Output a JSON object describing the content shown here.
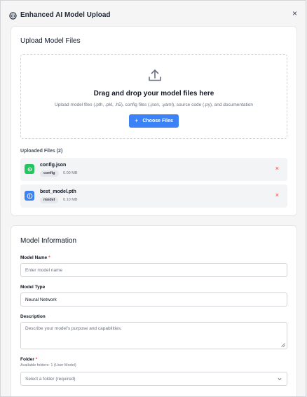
{
  "modal": {
    "title": "Enhanced AI Model Upload",
    "close_label": "×"
  },
  "upload": {
    "section_title": "Upload Model Files",
    "dropzone_title": "Drag and drop your model files here",
    "dropzone_subtitle": "Upload model files (.pth, .pkl, .h5), config files (.json, .yaml), source code (.py), and documentation",
    "choose_button": "Choose Files",
    "files_heading": "Uploaded Files (2)",
    "files": [
      {
        "name": "config.json",
        "tag": "config",
        "size": "0.00 MB",
        "icon": "gear-icon",
        "color": "#22c55e"
      },
      {
        "name": "best_model.pth",
        "tag": "model",
        "size": "0.10 MB",
        "icon": "brain-icon",
        "color": "#3b82f6"
      }
    ],
    "remove_label": "×"
  },
  "info": {
    "section_title": "Model Information",
    "model_name_label": "Model Name",
    "model_name_placeholder": "Enter model name",
    "model_type_label": "Model Type",
    "model_type_value": "Neural Network",
    "description_label": "Description",
    "description_placeholder": "Describe your model's purpose and capabilities.",
    "folder_label": "Folder",
    "folder_help": "Available folders: 1 (User Model)",
    "folder_placeholder": "Select a folder (required)",
    "required_mark": "*"
  },
  "colors": {
    "accent": "#3b82f6",
    "success": "#22c55e",
    "danger": "#ef4444"
  }
}
